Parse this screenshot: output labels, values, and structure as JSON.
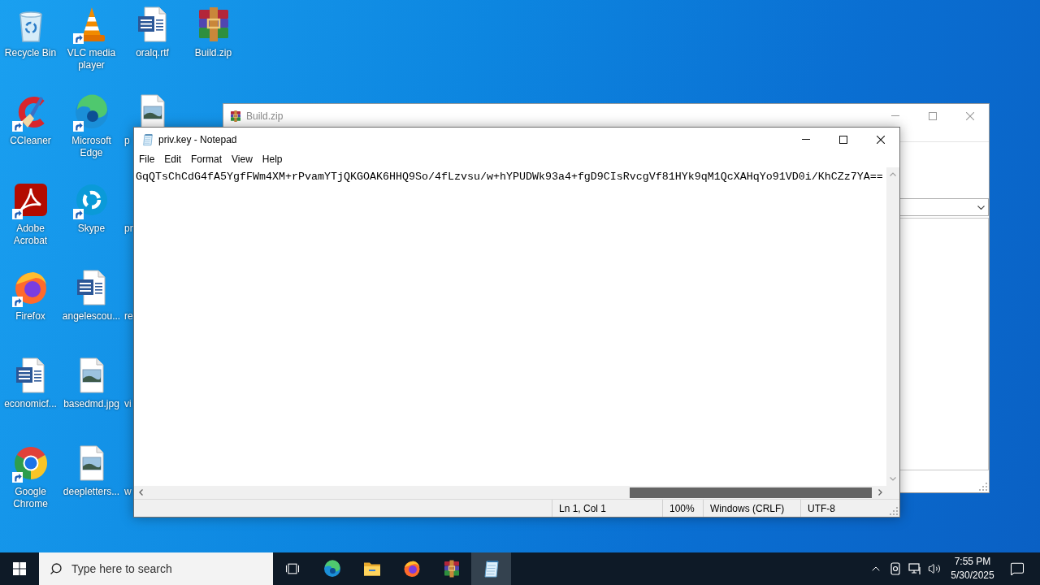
{
  "desktop_icons": [
    {
      "label": "Recycle Bin",
      "kind": "recycle",
      "shortcut": false,
      "clipped": false
    },
    {
      "label": "CCleaner",
      "kind": "ccleaner",
      "shortcut": true,
      "clipped": false
    },
    {
      "label": "Adobe Acrobat",
      "kind": "acrobat",
      "shortcut": true,
      "clipped": false
    },
    {
      "label": "Firefox",
      "kind": "firefox",
      "shortcut": true,
      "clipped": false
    },
    {
      "label": "economicf...",
      "kind": "word",
      "shortcut": false,
      "clipped": false
    },
    {
      "label": "Google Chrome",
      "kind": "chrome",
      "shortcut": true,
      "clipped": false
    },
    {
      "label": "VLC media player",
      "kind": "vlc",
      "shortcut": true,
      "clipped": false
    },
    {
      "label": "Microsoft Edge",
      "kind": "edge",
      "shortcut": true,
      "clipped": false
    },
    {
      "label": "Skype",
      "kind": "skype",
      "shortcut": true,
      "clipped": false
    },
    {
      "label": "angelescou...",
      "kind": "word",
      "shortcut": false,
      "clipped": false
    },
    {
      "label": "basedmd.jpg",
      "kind": "image",
      "shortcut": false,
      "clipped": false
    },
    {
      "label": "deepletters...",
      "kind": "image",
      "shortcut": false,
      "clipped": false
    },
    {
      "label": "oralq.rtf",
      "kind": "word",
      "shortcut": false,
      "clipped": false
    },
    {
      "label": "p",
      "kind": "image",
      "shortcut": false,
      "clipped": true
    },
    {
      "label": "pr",
      "shortcut": false,
      "clipped": true
    },
    {
      "label": "re",
      "shortcut": false,
      "clipped": true
    },
    {
      "label": "vi",
      "shortcut": false,
      "clipped": true
    },
    {
      "label": "w",
      "shortcut": false,
      "clipped": true
    },
    {
      "label": "Build.zip",
      "kind": "archive",
      "shortcut": false,
      "clipped": false
    }
  ],
  "archive_window": {
    "title": "Build.zip"
  },
  "notepad": {
    "title": "priv.key - Notepad",
    "menu": [
      "File",
      "Edit",
      "Format",
      "View",
      "Help"
    ],
    "text": "GqQTsChCdG4fA5YgfFWm4XM+rPvamYTjQKGOAK6HHQ9So/4fLzvsu/w+hYPUDWk93a4+fgD9CIsRvcgVf81HYk9qM1QcXAHqYo91VD0i/KhCZz7YA==",
    "status": [
      "Ln 1, Col 1",
      "100%",
      "Windows (CRLF)",
      "UTF-8"
    ]
  },
  "taskbar": {
    "search": {
      "placeholder": "Type here to search"
    },
    "apps": [
      {
        "kind": "taskview",
        "selected": false
      },
      {
        "kind": "edge",
        "selected": false
      },
      {
        "kind": "explorer",
        "selected": false
      },
      {
        "kind": "firefox",
        "selected": false
      },
      {
        "kind": "archive",
        "selected": false
      },
      {
        "kind": "notepad",
        "selected": true
      }
    ],
    "clock": {
      "time": "7:55 PM",
      "date": "5/30/2025"
    }
  }
}
